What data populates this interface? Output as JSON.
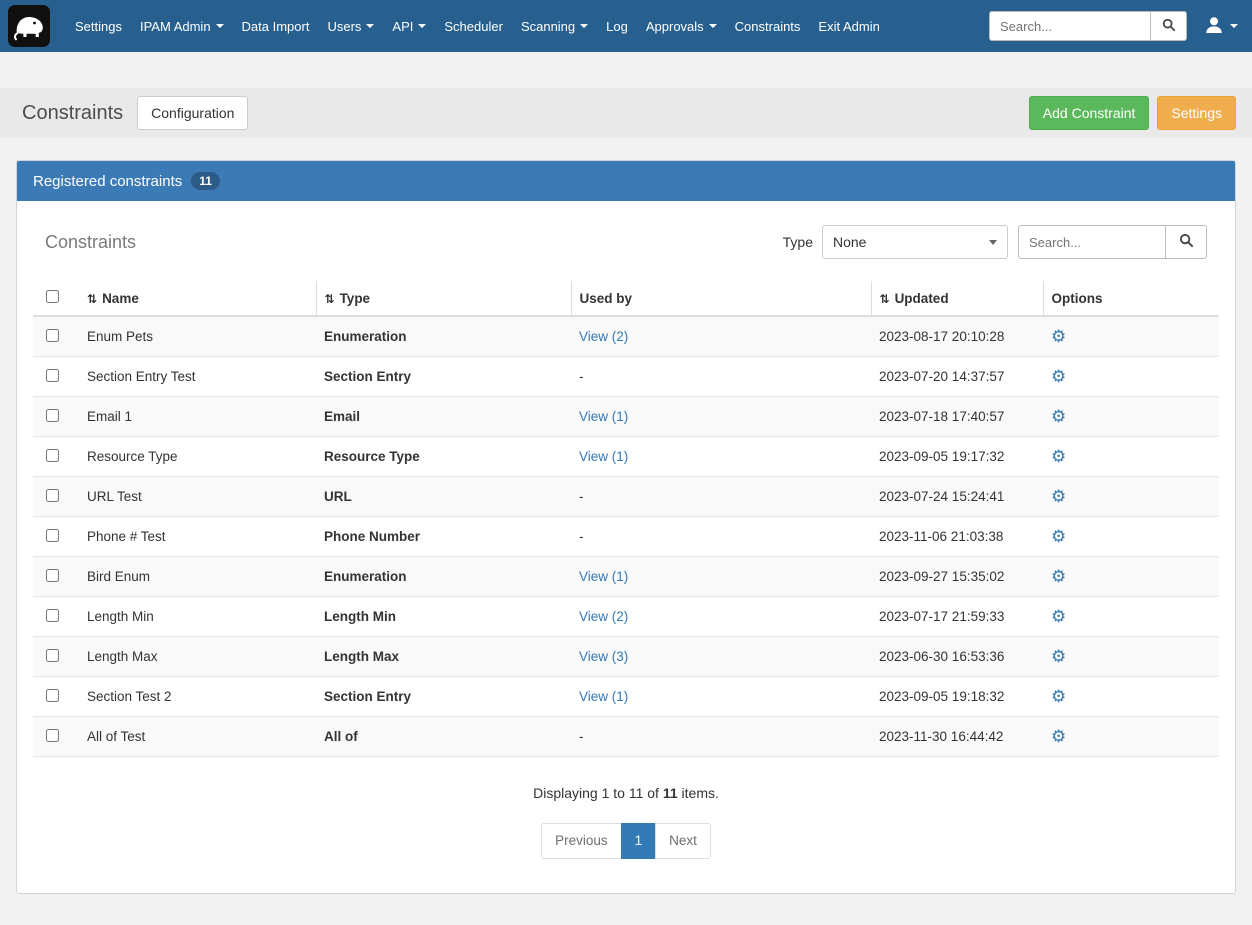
{
  "colors": {
    "navbar_bg": "#27608f",
    "panel_header_bg": "#3c7ab5",
    "accent_green": "#5cb85c",
    "accent_green_border": "#4cae4c",
    "accent_orange": "#f0ad4e",
    "accent_orange_border": "#eea236",
    "link_blue": "#337ab7"
  },
  "navbar": {
    "search_placeholder": "Search...",
    "items": [
      {
        "label": "Settings",
        "dropdown": false
      },
      {
        "label": "IPAM Admin",
        "dropdown": true
      },
      {
        "label": "Data Import",
        "dropdown": false
      },
      {
        "label": "Users",
        "dropdown": true
      },
      {
        "label": "API",
        "dropdown": true
      },
      {
        "label": "Scheduler",
        "dropdown": false
      },
      {
        "label": "Scanning",
        "dropdown": true
      },
      {
        "label": "Log",
        "dropdown": false
      },
      {
        "label": "Approvals",
        "dropdown": true
      },
      {
        "label": "Constraints",
        "dropdown": false
      },
      {
        "label": "Exit Admin",
        "dropdown": false
      }
    ]
  },
  "header": {
    "title": "Constraints",
    "configuration_button": "Configuration",
    "add_constraint_button": "Add Constraint",
    "settings_button": "Settings"
  },
  "panel": {
    "title": "Registered constraints",
    "count_badge": "11",
    "toolbar": {
      "title": "Constraints",
      "type_label": "Type",
      "type_value": "None",
      "search_placeholder": "Search..."
    },
    "table": {
      "columns": [
        {
          "label": "Name",
          "sortable": true
        },
        {
          "label": "Type",
          "sortable": true
        },
        {
          "label": "Used by",
          "sortable": false
        },
        {
          "label": "Updated",
          "sortable": true
        },
        {
          "label": "Options",
          "sortable": false
        }
      ],
      "rows": [
        {
          "name": "Enum Pets",
          "type": "Enumeration",
          "used_by": "View (2)",
          "updated": "2023-08-17 20:10:28"
        },
        {
          "name": "Section Entry Test",
          "type": "Section Entry",
          "used_by": "-",
          "updated": "2023-07-20 14:37:57"
        },
        {
          "name": "Email 1",
          "type": "Email",
          "used_by": "View (1)",
          "updated": "2023-07-18 17:40:57"
        },
        {
          "name": "Resource Type",
          "type": "Resource Type",
          "used_by": "View (1)",
          "updated": "2023-09-05 19:17:32"
        },
        {
          "name": "URL Test",
          "type": "URL",
          "used_by": "-",
          "updated": "2023-07-24 15:24:41"
        },
        {
          "name": "Phone # Test",
          "type": "Phone Number",
          "used_by": "-",
          "updated": "2023-11-06 21:03:38"
        },
        {
          "name": "Bird Enum",
          "type": "Enumeration",
          "used_by": "View (1)",
          "updated": "2023-09-27 15:35:02"
        },
        {
          "name": "Length Min",
          "type": "Length Min",
          "used_by": "View (2)",
          "updated": "2023-07-17 21:59:33"
        },
        {
          "name": "Length Max",
          "type": "Length Max",
          "used_by": "View (3)",
          "updated": "2023-06-30 16:53:36"
        },
        {
          "name": "Section Test 2",
          "type": "Section Entry",
          "used_by": "View (1)",
          "updated": "2023-09-05 19:18:32"
        },
        {
          "name": "All of Test",
          "type": "All of",
          "used_by": "-",
          "updated": "2023-11-30 16:44:42"
        }
      ]
    },
    "summary": {
      "prefix": "Displaying 1 to 11 of ",
      "count": "11",
      "suffix": " items."
    },
    "pagination": {
      "previous": "Previous",
      "current_page": "1",
      "next": "Next"
    }
  }
}
